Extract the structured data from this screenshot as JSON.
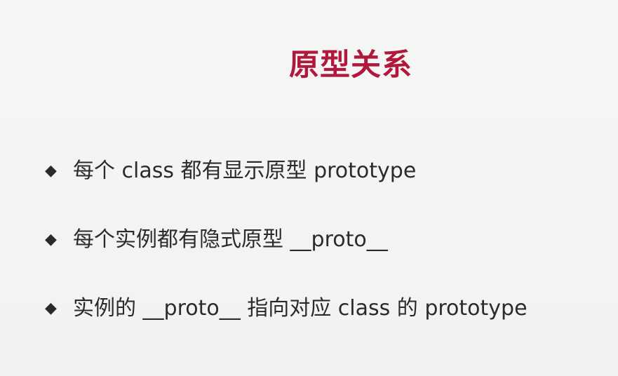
{
  "slide": {
    "title": "原型关系",
    "bullet_icon": "◆",
    "bullets": [
      {
        "text": "每个 class 都有显示原型 prototype"
      },
      {
        "text": "每个实例都有隐式原型 __proto__"
      },
      {
        "text": "实例的 __proto__ 指向对应 class 的 prototype"
      }
    ]
  },
  "colors": {
    "title": "#b0183c",
    "text": "#2b2b2b",
    "background": "#f4f5f4"
  }
}
